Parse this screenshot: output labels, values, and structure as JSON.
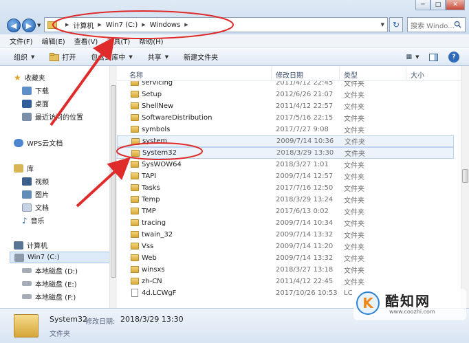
{
  "window": {
    "minimize_icon": "minimize-icon",
    "maximize_icon": "maximize-icon",
    "close_icon": "close-icon"
  },
  "address": {
    "crumbs": [
      "计算机",
      "Win7 (C:)",
      "Windows"
    ],
    "search_placeholder": "搜索 Windo..."
  },
  "menu": [
    "文件(F)",
    "编辑(E)",
    "查看(V)",
    "工具(T)",
    "帮助(H)"
  ],
  "toolbar": {
    "organize": "组织",
    "open": "打开",
    "include_in_library": "包含到库中",
    "share": "共享",
    "new_folder": "新建文件夹"
  },
  "nav": {
    "favorites": "收藏夹",
    "downloads": "下载",
    "desktop": "桌面",
    "recent": "最近访问的位置",
    "wps": "WPS云文档",
    "libraries": "库",
    "videos": "视频",
    "pictures": "图片",
    "documents": "文档",
    "music": "音乐",
    "computer": "计算机",
    "drive_c": "Win7 (C:)",
    "drive_d": "本地磁盘 (D:)",
    "drive_e": "本地磁盘 (E:)",
    "drive_f": "本地磁盘 (F:)"
  },
  "columns": {
    "name": "名称",
    "date": "修改日期",
    "type": "类型",
    "size": "大小"
  },
  "files": [
    {
      "name": "servicing",
      "date": "2011/4/12 22:45",
      "type": "文件夹",
      "kind": "folder"
    },
    {
      "name": "Setup",
      "date": "2012/6/26 21:07",
      "type": "文件夹",
      "kind": "folder"
    },
    {
      "name": "ShellNew",
      "date": "2011/4/12 22:57",
      "type": "文件夹",
      "kind": "folder"
    },
    {
      "name": "SoftwareDistribution",
      "date": "2017/5/16 22:15",
      "type": "文件夹",
      "kind": "folder"
    },
    {
      "name": "symbols",
      "date": "2017/7/27 9:08",
      "type": "文件夹",
      "kind": "folder"
    },
    {
      "name": "system",
      "date": "2009/7/14 10:36",
      "type": "文件夹",
      "kind": "folder"
    },
    {
      "name": "System32",
      "date": "2018/3/29 13:30",
      "type": "文件夹",
      "kind": "folder"
    },
    {
      "name": "SysWOW64",
      "date": "2018/3/27 1:01",
      "type": "文件夹",
      "kind": "folder"
    },
    {
      "name": "TAPI",
      "date": "2009/7/14 12:57",
      "type": "文件夹",
      "kind": "folder"
    },
    {
      "name": "Tasks",
      "date": "2017/7/16 12:50",
      "type": "文件夹",
      "kind": "folder"
    },
    {
      "name": "Temp",
      "date": "2018/3/29 13:24",
      "type": "文件夹",
      "kind": "folder"
    },
    {
      "name": "TMP",
      "date": "2017/6/13 0:02",
      "type": "文件夹",
      "kind": "folder"
    },
    {
      "name": "tracing",
      "date": "2009/7/14 10:34",
      "type": "文件夹",
      "kind": "folder"
    },
    {
      "name": "twain_32",
      "date": "2009/7/14 13:32",
      "type": "文件夹",
      "kind": "folder"
    },
    {
      "name": "Vss",
      "date": "2009/7/14 11:20",
      "type": "文件夹",
      "kind": "folder"
    },
    {
      "name": "Web",
      "date": "2009/7/14 13:32",
      "type": "文件夹",
      "kind": "folder"
    },
    {
      "name": "winsxs",
      "date": "2018/3/27 13:18",
      "type": "文件夹",
      "kind": "folder"
    },
    {
      "name": "zh-CN",
      "date": "2011/4/12 22:45",
      "type": "文件夹",
      "kind": "folder"
    },
    {
      "name": "4d.LCWgF",
      "date": "2017/10/26 10:53",
      "type": "LC",
      "kind": "file"
    }
  ],
  "details": {
    "name": "System32",
    "date_label": "修改日期:",
    "date": "2018/3/29 13:30",
    "type": "文件夹"
  },
  "watermark": {
    "logo": "K",
    "brand": "酷知网",
    "url": "www.coozhi.com"
  },
  "colors": {
    "annotation_red": "#e02b2b",
    "selection_blue": "#dce9f7"
  }
}
